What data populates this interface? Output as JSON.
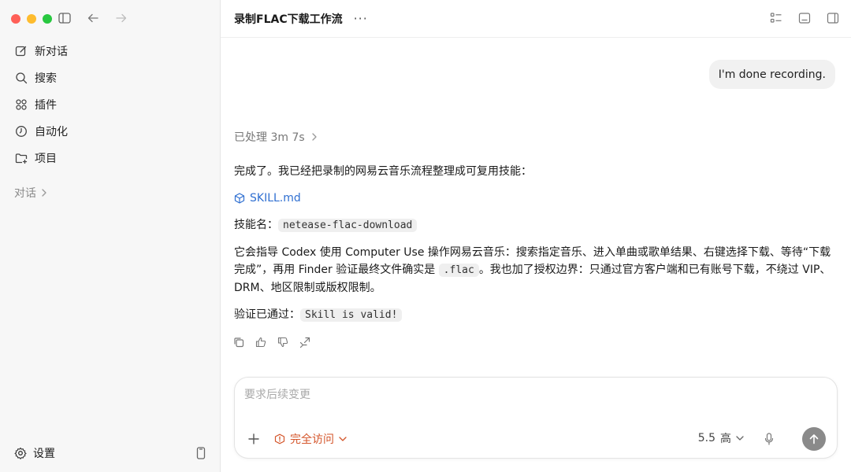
{
  "sidebar": {
    "items": [
      {
        "label": "新对话",
        "icon": "edit-icon"
      },
      {
        "label": "搜索",
        "icon": "search-icon"
      },
      {
        "label": "插件",
        "icon": "grid-icon"
      },
      {
        "label": "自动化",
        "icon": "clock-icon"
      },
      {
        "label": "项目",
        "icon": "folder-icon"
      }
    ],
    "section_label": "对话",
    "settings_label": "设置"
  },
  "header": {
    "title": "录制FLAC下载工作流",
    "more": "···"
  },
  "chat": {
    "user_message": "I'm done recording.",
    "processed": "已处理 3m 7s",
    "reply_intro": "完成了。我已经把录制的网易云音乐流程整理成可复用技能：",
    "file_link": "SKILL.md",
    "skill_name_label": "技能名：",
    "skill_name": "netease-flac-download",
    "desc_part1": "它会指导 Codex 使用 Computer Use 操作网易云音乐：搜索指定音乐、进入单曲或歌单结果、右键选择下载、等待“下载完成”，再用 Finder 验证最终文件确实是",
    "desc_code": ".flac",
    "desc_part2": "。我也加了授权边界：只通过官方客户端和已有账号下载，不绕过 VIP、DRM、地区限制或版权限制。",
    "verify_label": "验证已通过：",
    "verify_code": "Skill is valid!"
  },
  "composer": {
    "placeholder": "要求后续变更",
    "access_label": "完全访问",
    "model": "5.5",
    "reasoning": "高"
  },
  "colors": {
    "accent_link": "#2f6fd1",
    "warning": "#d4552a"
  }
}
